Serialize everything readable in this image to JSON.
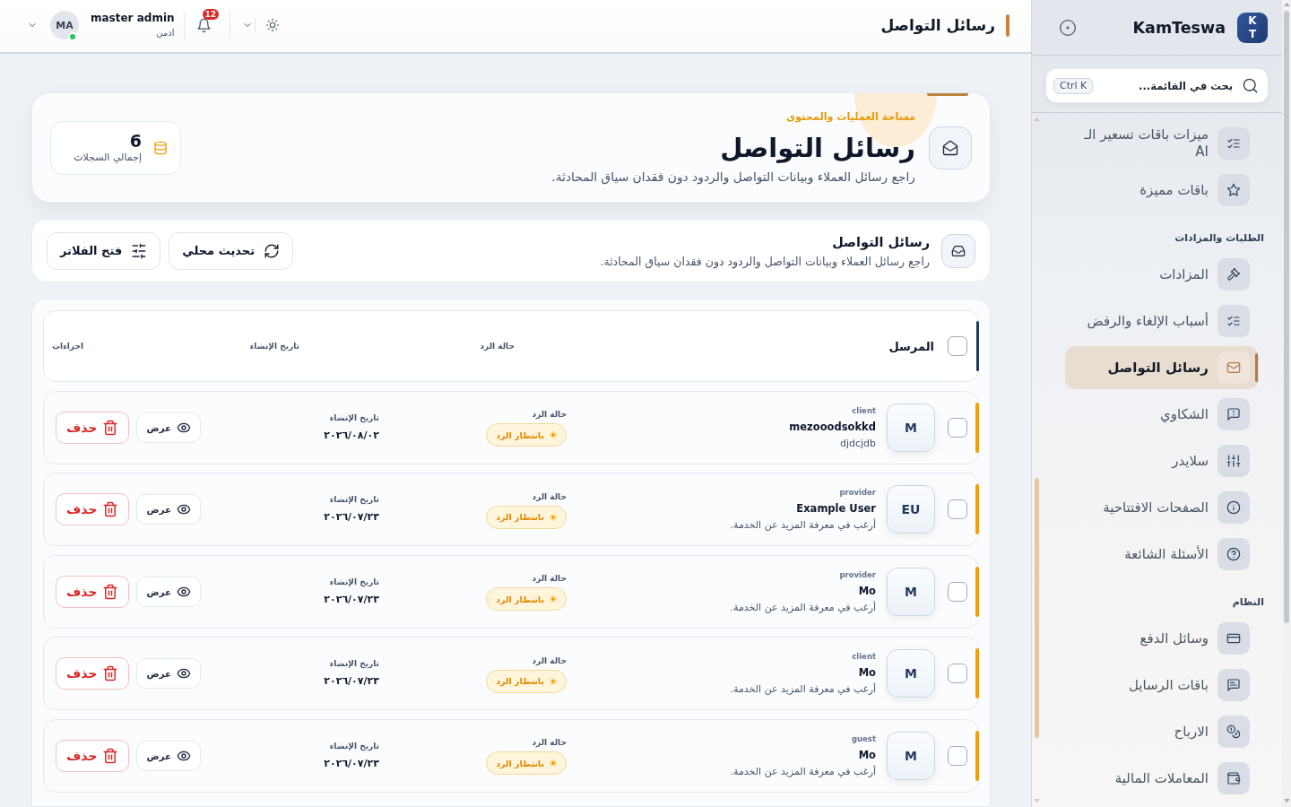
{
  "sidebar": {
    "logo": "K T",
    "brand": "KamTeswa",
    "search": {
      "placeholder": "بحث في القائمة...",
      "shortcut": "Ctrl K"
    },
    "sections": [
      {
        "items": [
          {
            "kind": "checklist",
            "label": "ميزات باقات تسعير الـ AI",
            "selected": false
          },
          {
            "kind": "star",
            "label": "باقات مميزة",
            "selected": false
          }
        ]
      },
      {
        "title": "الطلبات والمزادات",
        "items": [
          {
            "kind": "gavel",
            "label": "المزادات",
            "selected": false
          },
          {
            "kind": "checklist",
            "label": "أسباب الإلغاء والرفض",
            "selected": false
          },
          {
            "kind": "mail",
            "label": "رسائل التواصل",
            "selected": true
          },
          {
            "kind": "complaint",
            "label": "الشكاوي",
            "selected": false
          },
          {
            "kind": "sliders",
            "label": "سلايدر",
            "selected": false
          },
          {
            "kind": "info",
            "label": "الصفحات الافتتاحية",
            "selected": false
          },
          {
            "kind": "help",
            "label": "الأسئلة الشائعة",
            "selected": false
          }
        ]
      },
      {
        "title": "النظام",
        "items": [
          {
            "kind": "card",
            "label": "وسائل الدفع",
            "selected": false
          },
          {
            "kind": "chat",
            "label": "باقات الرسايل",
            "selected": false
          },
          {
            "kind": "coins",
            "label": "الارباح",
            "selected": false
          },
          {
            "kind": "wallet",
            "label": "المعاملات المالية",
            "selected": false
          }
        ]
      }
    ]
  },
  "header": {
    "title": "رسائل التواصل",
    "user": {
      "initials": "MA",
      "name": "master admin",
      "role": "ادمن",
      "online": true
    },
    "notifications": {
      "count": "12"
    }
  },
  "hero": {
    "eyebrow": "مساحة العمليات والمحتوى",
    "title": "رسائل التواصل",
    "description": "راجع رسائل العملاء وبيانات التواصل والردود دون فقدان سياق المحادثة.",
    "stat": {
      "value": "6",
      "label": "إجمالي السجلات"
    }
  },
  "toolbar": {
    "title": "رسائل التواصل",
    "subtitle": "راجع رسائل العملاء وبيانات التواصل والردود دون فقدان سياق المحادثة.",
    "buttons": [
      {
        "kind": "refresh",
        "label": "تحديث محلي"
      },
      {
        "kind": "filter",
        "label": "فتح الفلاتر"
      }
    ]
  },
  "table": {
    "header": {
      "checked": false,
      "columns": [
        "المرسل",
        "حالة الرد",
        "تاريخ الإنشاء",
        "اجراءات"
      ]
    },
    "rows": [
      {
        "checked": false,
        "initials": "M",
        "type": "client",
        "name": "mezooodsokkd",
        "message": "djdcjdb",
        "status_label": "حالة الرد",
        "status": {
          "kind": "pending",
          "text": "بانتظار الرد"
        },
        "date_label": "تاريخ الإنشاء",
        "date": "٢٠٢٦/٠٨/٠٢",
        "actions": [
          {
            "kind": "view",
            "label": "عرض"
          },
          {
            "kind": "delete",
            "label": "حذف"
          }
        ]
      },
      {
        "checked": false,
        "initials": "EU",
        "type": "provider",
        "name": "Example User",
        "message": "أرغب في معرفة المزيد عن الخدمة.",
        "status_label": "حالة الرد",
        "status": {
          "kind": "pending",
          "text": "بانتظار الرد"
        },
        "date_label": "تاريخ الإنشاء",
        "date": "٢٠٢٦/٠٧/٢٣",
        "actions": [
          {
            "kind": "view",
            "label": "عرض"
          },
          {
            "kind": "delete",
            "label": "حذف"
          }
        ]
      },
      {
        "checked": false,
        "initials": "M",
        "type": "provider",
        "name": "Mo",
        "message": "أرغب في معرفة المزيد عن الخدمة.",
        "status_label": "حالة الرد",
        "status": {
          "kind": "pending",
          "text": "بانتظار الرد"
        },
        "date_label": "تاريخ الإنشاء",
        "date": "٢٠٢٦/٠٧/٢٣",
        "actions": [
          {
            "kind": "view",
            "label": "عرض"
          },
          {
            "kind": "delete",
            "label": "حذف"
          }
        ]
      },
      {
        "checked": false,
        "initials": "M",
        "type": "client",
        "name": "Mo",
        "message": "أرغب في معرفة المزيد عن الخدمة.",
        "status_label": "حالة الرد",
        "status": {
          "kind": "pending",
          "text": "بانتظار الرد"
        },
        "date_label": "تاريخ الإنشاء",
        "date": "٢٠٢٦/٠٧/٢٣",
        "actions": [
          {
            "kind": "view",
            "label": "عرض"
          },
          {
            "kind": "delete",
            "label": "حذف"
          }
        ]
      },
      {
        "checked": false,
        "initials": "M",
        "type": "guest",
        "name": "Mo",
        "message": "أرغب في معرفة المزيد عن الخدمة.",
        "status_label": "حالة الرد",
        "status": {
          "kind": "pending",
          "text": "بانتظار الرد"
        },
        "date_label": "تاريخ الإنشاء",
        "date": "٢٠٢٦/٠٧/٢٣",
        "actions": [
          {
            "kind": "view",
            "label": "عرض"
          },
          {
            "kind": "delete",
            "label": "حذف"
          }
        ]
      }
    ]
  }
}
